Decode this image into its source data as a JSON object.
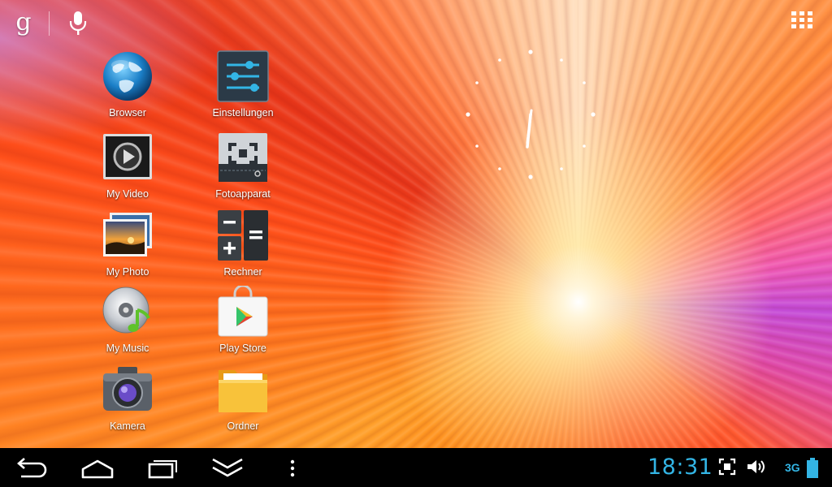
{
  "topbar": {
    "search_glyph": "g",
    "search_icon": "google-search-icon",
    "voice_icon": "mic-icon",
    "apps_icon": "all-apps-grid-icon"
  },
  "apps": [
    {
      "label": "Browser",
      "icon": "globe-icon"
    },
    {
      "label": "Einstellungen",
      "icon": "settings-sliders-icon"
    },
    {
      "label": "My Video",
      "icon": "video-play-icon"
    },
    {
      "label": "Fotoapparat",
      "icon": "camera-focus-icon"
    },
    {
      "label": "My Photo",
      "icon": "photo-gallery-icon"
    },
    {
      "label": "Rechner",
      "icon": "calculator-icon"
    },
    {
      "label": "My Music",
      "icon": "music-disc-icon"
    },
    {
      "label": "Play Store",
      "icon": "play-store-bag-icon"
    },
    {
      "label": "Kamera",
      "icon": "camera-icon"
    },
    {
      "label": "Ordner",
      "icon": "folder-icon"
    }
  ],
  "clock_widget": {
    "icon": "analog-clock-icon"
  },
  "navbar": {
    "back_icon": "back-icon",
    "home_icon": "home-icon",
    "recents_icon": "recent-apps-icon",
    "hide_icon": "hide-bar-chevron-icon",
    "menu_icon": "overflow-menu-icon",
    "time": "18:31",
    "screenshot_icon": "screenshot-icon",
    "volume_icon": "volume-icon",
    "network": "3G",
    "battery_icon": "battery-icon"
  },
  "colors": {
    "accent": "#33b5e5",
    "navbar": "#000000"
  }
}
